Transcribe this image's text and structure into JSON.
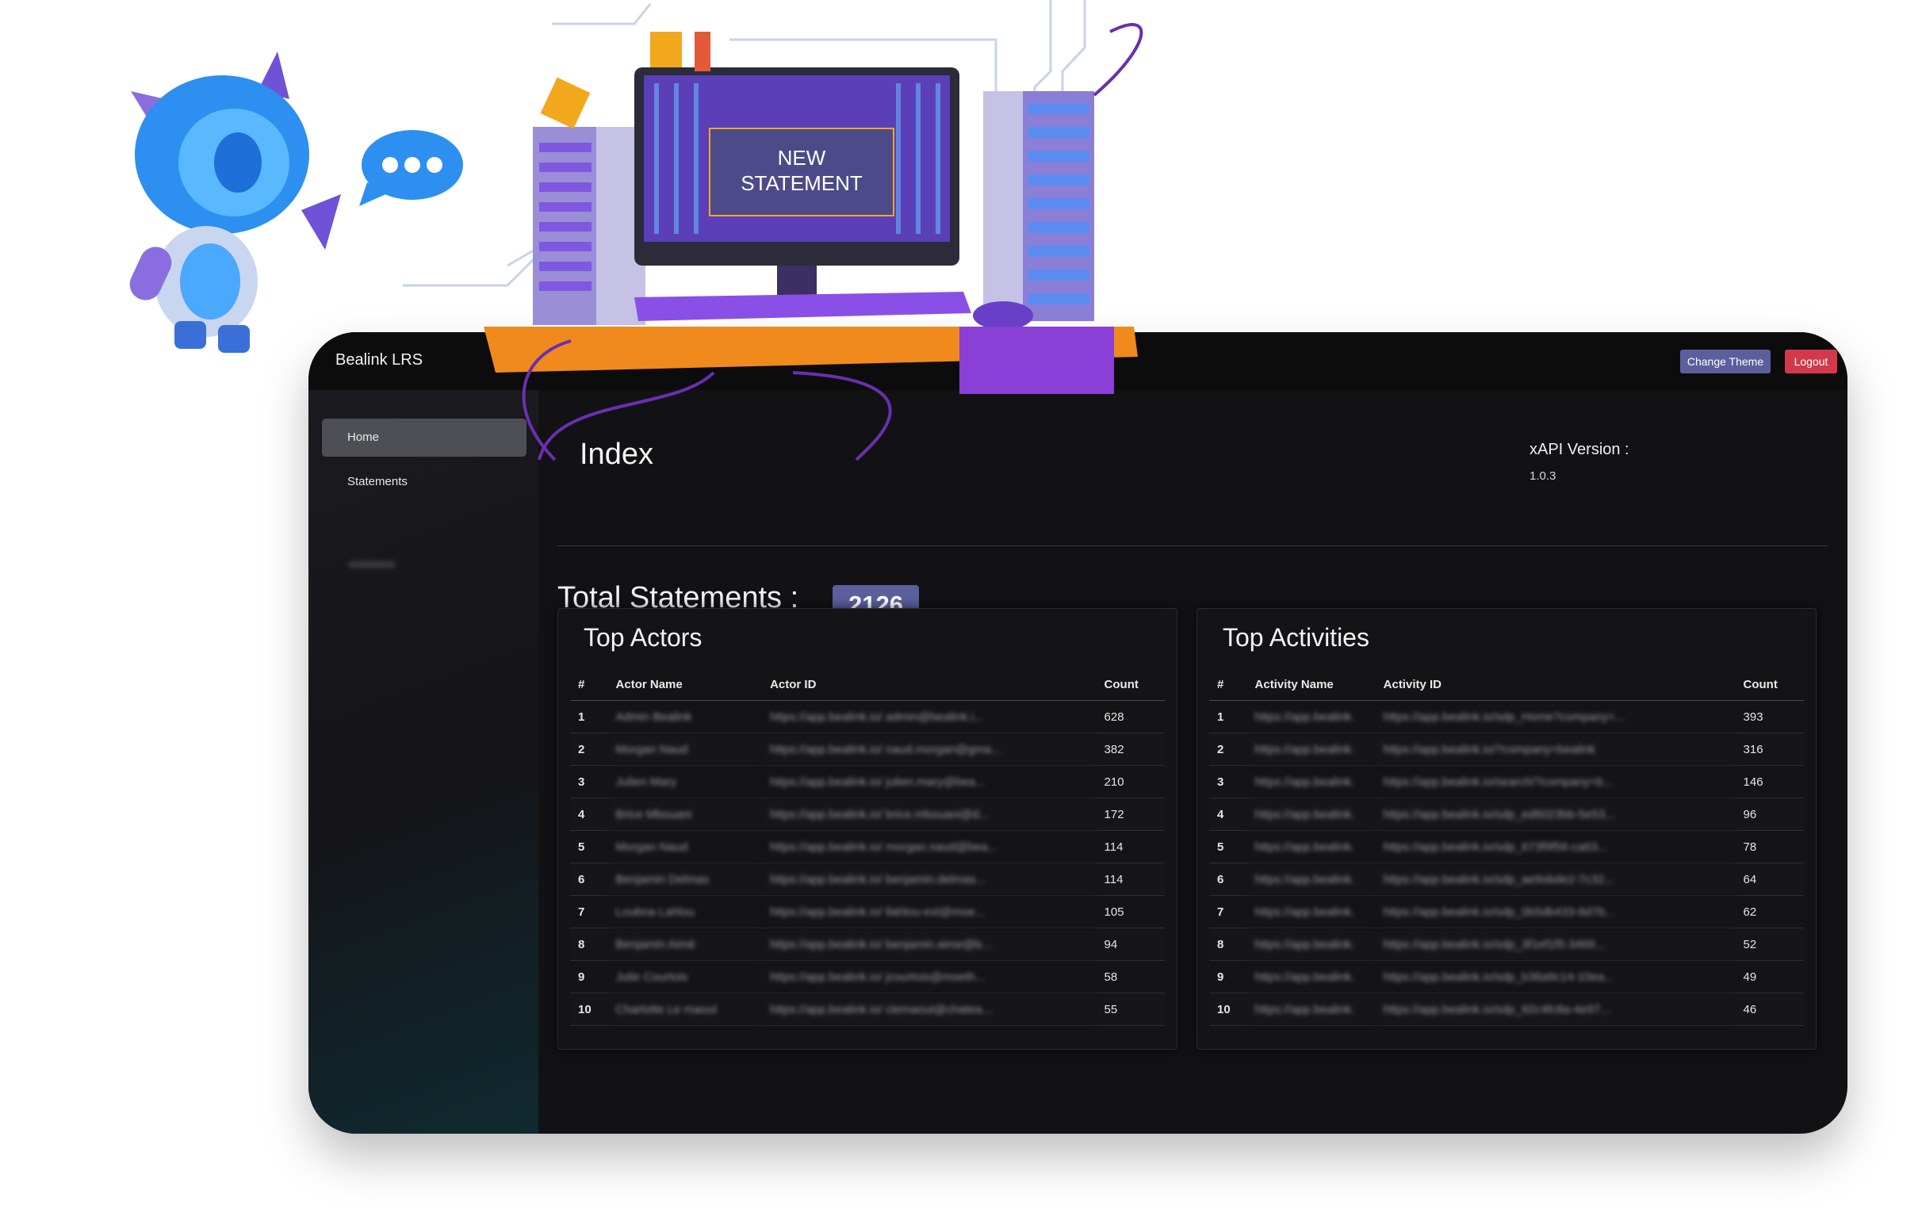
{
  "illustration": {
    "screen_text_line1": "NEW",
    "screen_text_line2": "STATEMENT"
  },
  "header": {
    "brand": "Bealink LRS",
    "change_theme_label": "Change Theme",
    "logout_label": "Logout"
  },
  "sidebar": {
    "items": [
      {
        "label": "Home"
      },
      {
        "label": "Statements"
      }
    ]
  },
  "main": {
    "title": "Index",
    "xapi_label": "xAPI Version :",
    "xapi_value": "1.0.3",
    "total_label": "Total Statements :",
    "total_value": "2126"
  },
  "top_actors": {
    "title": "Top Actors",
    "columns": [
      "#",
      "Actor Name",
      "Actor ID",
      "Count"
    ],
    "rows": [
      {
        "n": "1",
        "name": "Admin Bealink",
        "id": "https://app.bealink.io/ admin@bealink.i...",
        "count": "628"
      },
      {
        "n": "2",
        "name": "Morgan Naud",
        "id": "https://app.bealink.io/ naud.morgan@gma...",
        "count": "382"
      },
      {
        "n": "3",
        "name": "Julien Mary",
        "id": "https://app.bealink.io/ julien.mary@bea...",
        "count": "210"
      },
      {
        "n": "4",
        "name": "Brice Mbouani",
        "id": "https://app.bealink.io/ brice.mbouani@d...",
        "count": "172"
      },
      {
        "n": "5",
        "name": "Morgan Naud",
        "id": "https://app.bealink.io/ morgan.naud@bea...",
        "count": "114"
      },
      {
        "n": "6",
        "name": "Benjamin Delmas",
        "id": "https://app.bealink.io/ benjamin.delmas...",
        "count": "114"
      },
      {
        "n": "7",
        "name": "Loubna Lahlou",
        "id": "https://app.bealink.io/ llahlou-ext@moe...",
        "count": "105"
      },
      {
        "n": "8",
        "name": "Benjamin Aimé",
        "id": "https://app.bealink.io/ benjamin.aime@b...",
        "count": "94"
      },
      {
        "n": "9",
        "name": "Julie Courtois",
        "id": "https://app.bealink.io/ jcourtois@moeth...",
        "count": "58"
      },
      {
        "n": "10",
        "name": "Charlotte Le maout",
        "id": "https://app.bealink.io/ clemaout@chatea...",
        "count": "55"
      }
    ]
  },
  "top_activities": {
    "title": "Top Activities",
    "columns": [
      "#",
      "Activity Name",
      "Activity ID",
      "Count"
    ],
    "rows": [
      {
        "n": "1",
        "name": "https://app.bealink.",
        "id": "https://app.bealink.io/sdp_Home?company=...",
        "count": "393"
      },
      {
        "n": "2",
        "name": "https://app.bealink.",
        "id": "https://app.bealink.io/?company=bealink",
        "count": "316"
      },
      {
        "n": "3",
        "name": "https://app.bealink.",
        "id": "https://app.bealink.io/search/?company=b...",
        "count": "146"
      },
      {
        "n": "4",
        "name": "https://app.bealink.",
        "id": "https://app.bealink.io/sdp_ed6023bb-5e53...",
        "count": "96"
      },
      {
        "n": "5",
        "name": "https://app.bealink.",
        "id": "https://app.bealink.io/sdp_673f9f56-ca63...",
        "count": "78"
      },
      {
        "n": "6",
        "name": "https://app.bealink.",
        "id": "https://app.bealink.io/sdp_ae9obde2-7c32...",
        "count": "64"
      },
      {
        "n": "7",
        "name": "https://app.bealink.",
        "id": "https://app.bealink.io/sdp_0b5db433-8d7b...",
        "count": "62"
      },
      {
        "n": "8",
        "name": "https://app.bealink.",
        "id": "https://app.bealink.io/sdp_3f1ef1f5-3469...",
        "count": "52"
      },
      {
        "n": "9",
        "name": "https://app.bealink.",
        "id": "https://app.bealink.io/sdp_b36a9c14-10ea...",
        "count": "49"
      },
      {
        "n": "10",
        "name": "https://app.bealink.",
        "id": "https://app.bealink.io/sdp_92c4fc8a-4e97...",
        "count": "46"
      }
    ]
  },
  "colors": {
    "accent": "#5b5f9c",
    "danger": "#d23a4b",
    "background": "#121214"
  }
}
